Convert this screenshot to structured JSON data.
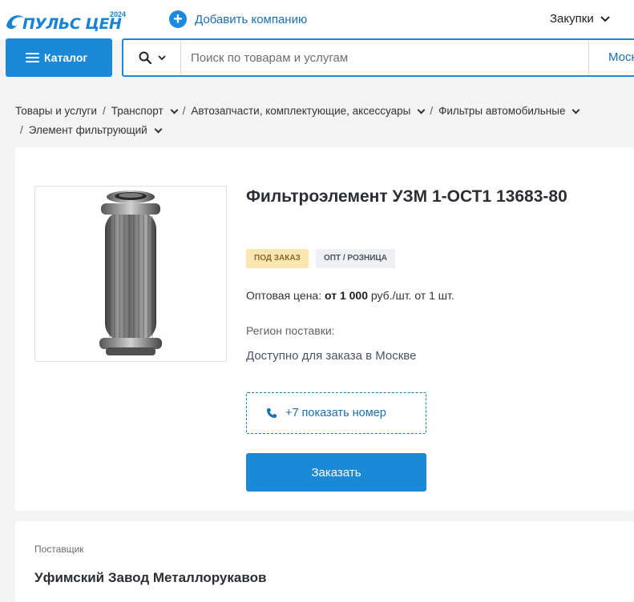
{
  "header": {
    "logo_text": "ПУЛЬС ЦЕН",
    "logo_year": "2024",
    "add_company_label": "Добавить компанию",
    "purchases_label": "Закупки"
  },
  "search": {
    "catalog_label": "Каталог",
    "placeholder": "Поиск по товарам и услугам",
    "region": "Москва"
  },
  "breadcrumbs": [
    {
      "label": "Товары и услуги",
      "dropdown": false
    },
    {
      "label": "Транспорт",
      "dropdown": true
    },
    {
      "label": "Автозапчасти, комплектующие, аксессуары",
      "dropdown": true
    },
    {
      "label": "Фильтры автомобильные",
      "dropdown": true
    },
    {
      "label": "Элемент фильтрующий",
      "dropdown": true
    }
  ],
  "product": {
    "title": "Фильтроэлемент УЗМ 1-ОСТ1 13683-80",
    "tags": [
      "Под заказ",
      "Опт / розница"
    ],
    "price_label": "Оптовая цена:",
    "price_value": "от 1 000",
    "price_unit": "руб./шт. от 1 шт.",
    "region_label": "Регион поставки:",
    "region_value": "Доступно для заказа в Москве",
    "phone_label": "+7 показать номер",
    "order_label": "Заказать"
  },
  "supplier": {
    "label": "Поставщик",
    "name": "Уфимский Завод Металлорукавов"
  },
  "colors": {
    "accent": "#1b88d8",
    "link": "#1a6fb5",
    "tag_order_bg": "#fbe6b1",
    "tag_opt_bg": "#eef0f3"
  },
  "icons": [
    "logo-wave-icon",
    "plus-circle-icon",
    "chevron-down-icon",
    "menu-icon",
    "search-icon",
    "phone-icon"
  ]
}
